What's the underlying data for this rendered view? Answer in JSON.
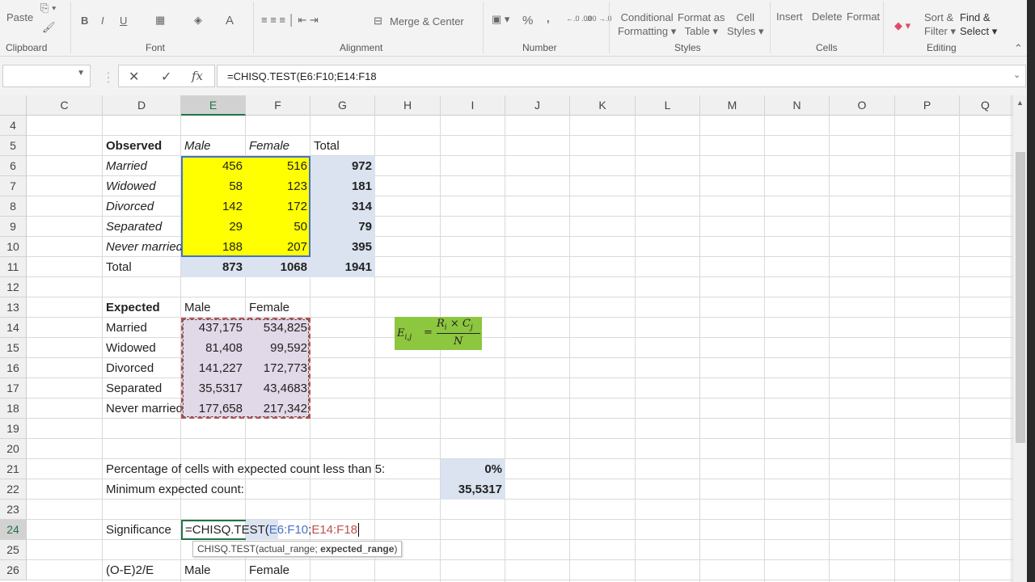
{
  "ribbon": {
    "clipboard": {
      "paste": "Paste",
      "group": "Clipboard"
    },
    "font": {
      "bold": "B",
      "italic": "I",
      "underline": "U",
      "font_color": "A",
      "group": "Font"
    },
    "alignment": {
      "merge_center": "Merge & Center",
      "group": "Alignment"
    },
    "number": {
      "percent": "%",
      "comma": ",",
      "inc_decimal": "←.0 .00",
      "dec_decimal": ".00 →.0",
      "group": "Number"
    },
    "styles": {
      "conditional": "Conditional",
      "conditional2": "Formatting",
      "format_table": "Format as",
      "format_table2": "Table",
      "cell_styles": "Cell",
      "cell_styles2": "Styles",
      "group": "Styles"
    },
    "cells": {
      "insert": "Insert",
      "delete": "Delete",
      "format": "Format",
      "group": "Cells"
    },
    "editing": {
      "sort": "Sort &",
      "sort2": "Filter",
      "find": "Find &",
      "find2": "Select",
      "group": "Editing"
    }
  },
  "formula_bar": {
    "name_box": "",
    "cancel": "✕",
    "enter": "✓",
    "fx": "fx",
    "formula": "=CHISQ.TEST(E6:F10;E14:F18"
  },
  "columns": [
    "C",
    "D",
    "E",
    "F",
    "G",
    "H",
    "I",
    "J",
    "K",
    "L",
    "M",
    "N",
    "O",
    "P",
    "Q"
  ],
  "selected_column": "E",
  "rows": [
    "4",
    "5",
    "6",
    "7",
    "8",
    "9",
    "10",
    "11",
    "12",
    "13",
    "14",
    "15",
    "16",
    "17",
    "18",
    "19",
    "20",
    "21",
    "22",
    "23",
    "24",
    "25",
    "26"
  ],
  "selected_row": "24",
  "colors": {
    "observed_fill": "#ffff00",
    "selection_fill": "#dbe3f1",
    "expected_fill": "#e2d9e8",
    "equation_fill": "#8dc63f",
    "excel_green": "#217346"
  },
  "cells": [
    {
      "ref": "D5",
      "v": "Observed",
      "s": "b"
    },
    {
      "ref": "E5",
      "v": "Male",
      "s": "i"
    },
    {
      "ref": "F5",
      "v": "Female",
      "s": "i"
    },
    {
      "ref": "G5",
      "v": "Total"
    },
    {
      "ref": "D6",
      "v": "Married",
      "s": "i"
    },
    {
      "ref": "E6",
      "v": "456",
      "s": "r y"
    },
    {
      "ref": "F6",
      "v": "516",
      "s": "r y"
    },
    {
      "ref": "G6",
      "v": "972",
      "s": "r sb"
    },
    {
      "ref": "D7",
      "v": "Widowed",
      "s": "i"
    },
    {
      "ref": "E7",
      "v": "58",
      "s": "r y"
    },
    {
      "ref": "F7",
      "v": "123",
      "s": "r y"
    },
    {
      "ref": "G7",
      "v": "181",
      "s": "r sb"
    },
    {
      "ref": "D8",
      "v": "Divorced",
      "s": "i"
    },
    {
      "ref": "E8",
      "v": "142",
      "s": "r y"
    },
    {
      "ref": "F8",
      "v": "172",
      "s": "r y"
    },
    {
      "ref": "G8",
      "v": "314",
      "s": "r sb"
    },
    {
      "ref": "D9",
      "v": "Separated",
      "s": "i"
    },
    {
      "ref": "E9",
      "v": "29",
      "s": "r y"
    },
    {
      "ref": "F9",
      "v": "50",
      "s": "r y"
    },
    {
      "ref": "G9",
      "v": "79",
      "s": "r sb"
    },
    {
      "ref": "D10",
      "v": "Never married",
      "s": "i"
    },
    {
      "ref": "E10",
      "v": "188",
      "s": "r y"
    },
    {
      "ref": "F10",
      "v": "207",
      "s": "r y"
    },
    {
      "ref": "G10",
      "v": "395",
      "s": "r sb"
    },
    {
      "ref": "D11",
      "v": "Total"
    },
    {
      "ref": "E11",
      "v": "873",
      "s": "r sb"
    },
    {
      "ref": "F11",
      "v": "1068",
      "s": "r sb"
    },
    {
      "ref": "G11",
      "v": "1941",
      "s": "r sb"
    },
    {
      "ref": "D13",
      "v": "Expected",
      "s": "b"
    },
    {
      "ref": "E13",
      "v": "Male"
    },
    {
      "ref": "F13",
      "v": "Female"
    },
    {
      "ref": "D14",
      "v": "Married"
    },
    {
      "ref": "E14",
      "v": "437,175",
      "s": "r p"
    },
    {
      "ref": "F14",
      "v": "534,825",
      "s": "r p"
    },
    {
      "ref": "D15",
      "v": "Widowed"
    },
    {
      "ref": "E15",
      "v": "81,408",
      "s": "r p"
    },
    {
      "ref": "F15",
      "v": "99,592",
      "s": "r p"
    },
    {
      "ref": "D16",
      "v": "Divorced"
    },
    {
      "ref": "E16",
      "v": "141,227",
      "s": "r p"
    },
    {
      "ref": "F16",
      "v": "172,773",
      "s": "r p"
    },
    {
      "ref": "D17",
      "v": "Separated"
    },
    {
      "ref": "E17",
      "v": "35,5317",
      "s": "r p"
    },
    {
      "ref": "F17",
      "v": "43,4683",
      "s": "r p"
    },
    {
      "ref": "D18",
      "v": "Never married"
    },
    {
      "ref": "E18",
      "v": "177,658",
      "s": "r p"
    },
    {
      "ref": "F18",
      "v": "217,342",
      "s": "r p"
    },
    {
      "ref": "D21",
      "v": "Percentage of cells with expected count less than 5:",
      "s": "o"
    },
    {
      "ref": "I21",
      "v": "0%",
      "s": "r sb"
    },
    {
      "ref": "D22",
      "v": "Minimum expected count:",
      "s": "o"
    },
    {
      "ref": "I22",
      "v": "35,5317",
      "s": "r sb"
    },
    {
      "ref": "D24",
      "v": "Significance"
    },
    {
      "ref": "D26",
      "v": "(O-E)2/E"
    },
    {
      "ref": "E26",
      "v": "Male"
    },
    {
      "ref": "F26",
      "v": "Female"
    }
  ],
  "editing_cell": {
    "ref": "E24",
    "prefix": "=CHISQ.TEST(",
    "range1": "E6:F10",
    "sep": ";",
    "range2": "E14:F18",
    "range1_color": "#4472c4",
    "range2_color": "#c0504d"
  },
  "tooltip": {
    "func": "CHISQ.TEST(actual_range; ",
    "arg": "expected_range",
    "close": ")"
  },
  "equation": {
    "lhs": "E",
    "lhs_sub": "i,j",
    "eq": "=",
    "num": "R",
    "num_sub": "i",
    "times": "×",
    "num2": "C",
    "num2_sub": "j",
    "den": "N"
  }
}
